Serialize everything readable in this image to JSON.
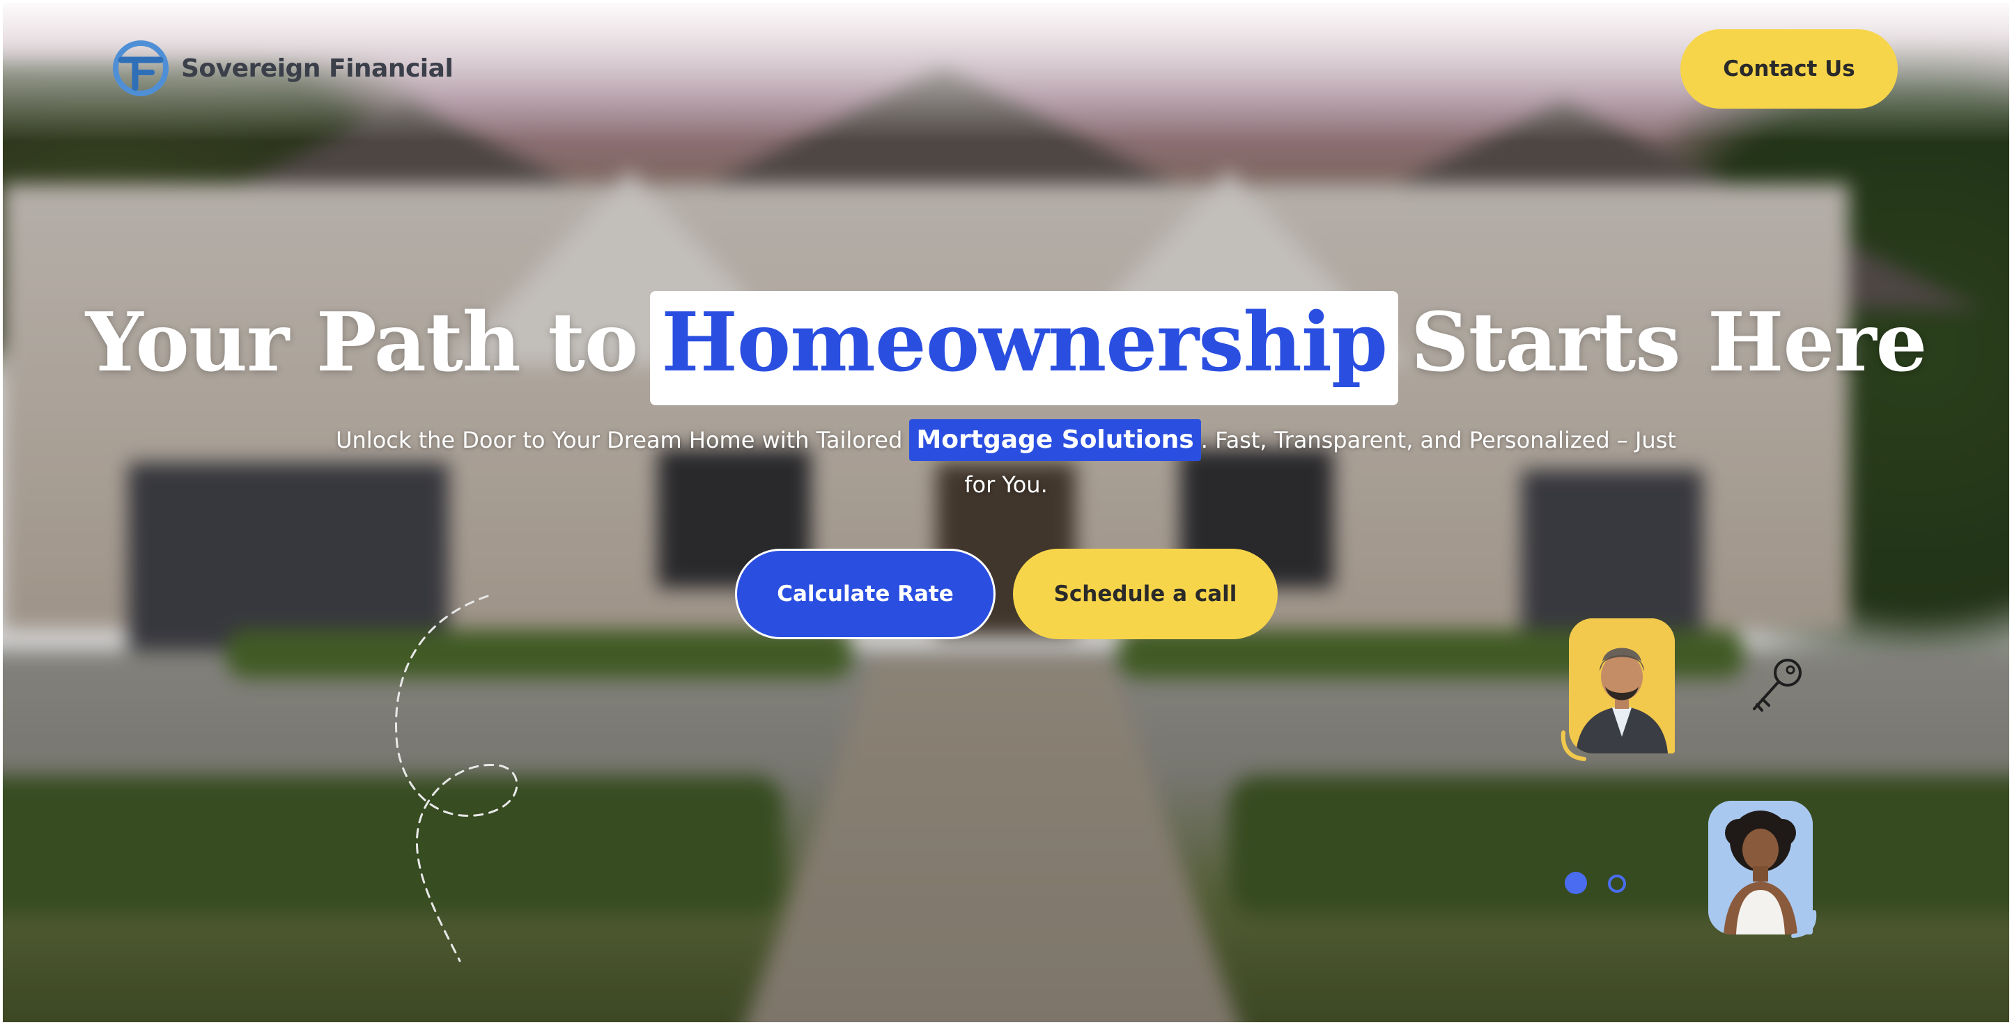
{
  "header": {
    "brand_name": "Sovereign Financial",
    "contact_label": "Contact Us"
  },
  "hero": {
    "headline_before": "Your Path to",
    "headline_highlight": "Homeownership",
    "headline_after": "Starts Here",
    "sub_before": "Unlock the Door to Your Dream Home with Tailored",
    "sub_highlight": "Mortgage Solutions",
    "sub_after": ". Fast, Transparent, and Personalized – Just for You.",
    "primary_cta": "Calculate Rate",
    "secondary_cta": "Schedule a call"
  },
  "carousel": {
    "slide_count": 2,
    "active_slide": 1
  },
  "icons": {
    "logo": "sovereign-logo-icon",
    "key": "key-icon",
    "decoration": "dashed-loop-path"
  },
  "colors": {
    "brand_blue": "#2a4fe0",
    "accent_yellow": "#f7d54a",
    "text_dark": "#3a3f4a",
    "white": "#ffffff"
  }
}
